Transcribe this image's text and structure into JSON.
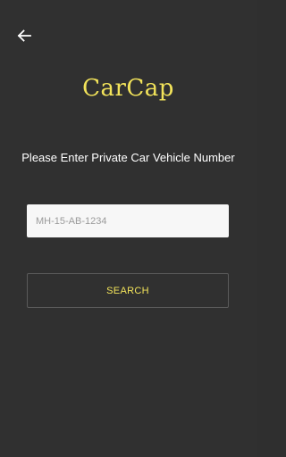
{
  "app": {
    "title": "CarCap"
  },
  "header": {
    "back_icon": "arrow-left-icon"
  },
  "main": {
    "prompt": "Please Enter Private Car Vehicle Number",
    "vehicle_number": {
      "value": "",
      "placeholder": "MH-15-AB-1234"
    },
    "search_label": "SEARCH"
  },
  "colors": {
    "background": "#303030",
    "accent": "#f2e35a",
    "text": "#ffffff",
    "input_background": "#f7f7f7",
    "button_border": "#5a5a5a"
  }
}
